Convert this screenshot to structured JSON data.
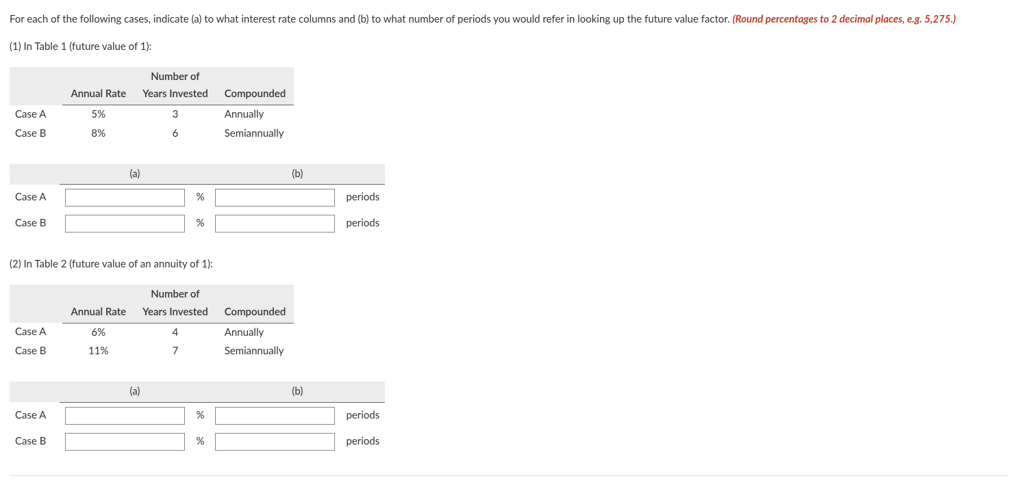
{
  "instruction": {
    "main": "For each of the following cases, indicate (a) to what interest rate columns and (b) to what number of periods you would refer in looking up the future value factor. ",
    "hint": "(Round percentages to 2 decimal places, e.g. 5,275.)"
  },
  "headers": {
    "annual_rate": "Annual Rate",
    "number_of": "Number of",
    "years_invested": "Years Invested",
    "compounded": "Compounded",
    "col_a": "(a)",
    "col_b": "(b)"
  },
  "units": {
    "percent": "%",
    "periods": "periods"
  },
  "parts": [
    {
      "label": "(1) In Table 1 (future value of 1):",
      "given": [
        {
          "case": "Case A",
          "rate": "5%",
          "years": "3",
          "compounded": "Annually"
        },
        {
          "case": "Case B",
          "rate": "8%",
          "years": "6",
          "compounded": "Semiannually"
        }
      ],
      "answers": [
        {
          "case": "Case A",
          "rate_value": "",
          "periods_value": ""
        },
        {
          "case": "Case B",
          "rate_value": "",
          "periods_value": ""
        }
      ]
    },
    {
      "label": "(2) In Table 2 (future value of an annuity of 1):",
      "given": [
        {
          "case": "Case A",
          "rate": "6%",
          "years": "4",
          "compounded": "Annually"
        },
        {
          "case": "Case B",
          "rate": "11%",
          "years": "7",
          "compounded": "Semiannually"
        }
      ],
      "answers": [
        {
          "case": "Case A",
          "rate_value": "",
          "periods_value": ""
        },
        {
          "case": "Case B",
          "rate_value": "",
          "periods_value": ""
        }
      ]
    }
  ]
}
